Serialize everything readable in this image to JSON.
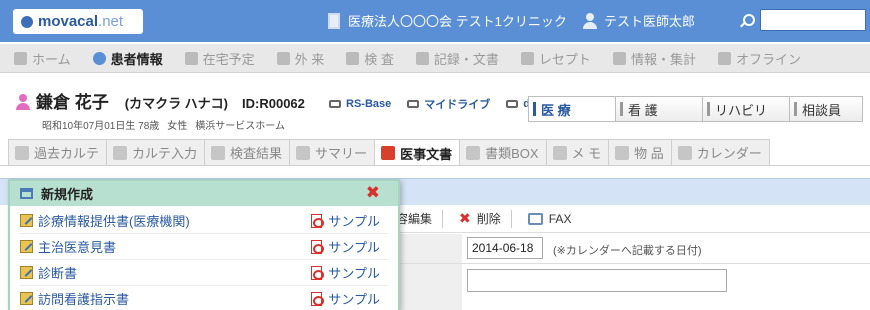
{
  "header": {
    "logo_brand": "movacal",
    "logo_tld": ".net",
    "clinic": "医療法人〇〇〇会 テスト1クリニック",
    "doctor": "テスト医師太郎",
    "search_value": ""
  },
  "nav": [
    {
      "label": "ホーム",
      "icon": "home-icon",
      "active": false
    },
    {
      "label": "患者情報",
      "icon": "patients-icon",
      "active": true
    },
    {
      "label": "在宅予定",
      "icon": "clock-icon",
      "active": false
    },
    {
      "label": "外 来",
      "icon": "outpatient-icon",
      "active": false
    },
    {
      "label": "検 査",
      "icon": "inspection-icon",
      "active": false
    },
    {
      "label": "記録・文書",
      "icon": "record-icon",
      "active": false
    },
    {
      "label": "レセプト",
      "icon": "receipt-icon",
      "active": false
    },
    {
      "label": "情報・集計",
      "icon": "stats-icon",
      "active": false
    },
    {
      "label": "オフライン",
      "icon": "offline-icon",
      "active": false
    }
  ],
  "patient": {
    "name": "鎌倉 花子",
    "kana": "(カマクラ ハナコ)",
    "id": "ID:R00062",
    "birth": "昭和10年07月01日生 78歳",
    "sex": "女性",
    "facility": "横浜サービスホーム"
  },
  "drives": [
    "RS-Base",
    "マイドライブ",
    "d"
  ],
  "departments": [
    {
      "label": "医 療",
      "active": true
    },
    {
      "label": "看 護",
      "active": false
    },
    {
      "label": "リハビリ",
      "active": false
    },
    {
      "label": "相談員",
      "active": false
    }
  ],
  "tabs": [
    {
      "label": "過去カルテ",
      "icon": "history-icon",
      "active": false
    },
    {
      "label": "カルテ入力",
      "icon": "edit-icon",
      "active": false
    },
    {
      "label": "検査結果",
      "icon": "chart-icon",
      "active": false
    },
    {
      "label": "サマリー",
      "icon": "summary-icon",
      "active": false
    },
    {
      "label": "医事文書",
      "icon": "pdf-icon",
      "active": true
    },
    {
      "label": "書類BOX",
      "icon": "box-icon",
      "active": false
    },
    {
      "label": "メ モ",
      "icon": "memo-icon",
      "active": false
    },
    {
      "label": "物 品",
      "icon": "goods-icon",
      "active": false
    },
    {
      "label": "カレンダー",
      "icon": "calendar-icon",
      "active": false
    }
  ],
  "toolbar": {
    "edit_label": "容編集",
    "delete_label": "削除",
    "fax_label": "FAX"
  },
  "form": {
    "date_value": "2014-06-18",
    "date_note": "(※カレンダーへ記載する日付)",
    "text_value": ""
  },
  "panel": {
    "title": "新規作成",
    "sample_label": "サンプル",
    "items": [
      "診療情報提供書(医療機関)",
      "主治医意見書",
      "診断書",
      "訪問看護指示書"
    ]
  }
}
